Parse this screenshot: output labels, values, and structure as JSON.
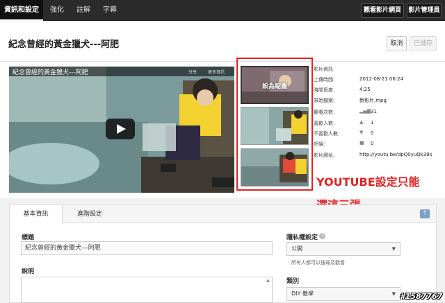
{
  "nav": {
    "tabs": [
      "資訊和設定",
      "強化",
      "註解",
      "字幕"
    ],
    "view_page_button": "觀看影片網頁",
    "video_manager_button": "影片管理員"
  },
  "header": {
    "video_title": "紀念曾經的黃金獵犬---阿肥",
    "cancel_label": "取消",
    "saved_label": "已儲存"
  },
  "player": {
    "title": "紀念曾經的黃金獵犬---阿肥",
    "share_label": "分享",
    "more_label": "更多資訊"
  },
  "thumbnails": {
    "selected_label": "設為縮圖"
  },
  "info": {
    "heading": "影片資訊",
    "upload_time_label": "上傳時間:",
    "upload_time": "2012-08-21 06:24",
    "duration_label": "時間長度:",
    "duration": "4:25",
    "original_file_label": "原始檔案:",
    "original_file": "新影片.mpg",
    "views_label": "觀看次數:",
    "views": "31",
    "likes_label": "喜歡人數:",
    "likes": "1",
    "dislikes_label": "不喜歡人數:",
    "dislikes": "0",
    "comments_label": "評論:",
    "comments": "0",
    "url_label": "影片網址:",
    "url": "http://youtu.be/dpQ0yuQk39s"
  },
  "annotation": {
    "line1": "YOUTUBE設定只能",
    "line2": "選這三張"
  },
  "form": {
    "tabs": [
      "基本資訊",
      "進階設定"
    ],
    "title_label": "標題",
    "title_value": "紀念曾經的黃金獵犬---阿肥",
    "description_label": "說明",
    "privacy_label": "隱私權設定",
    "privacy_value": "公開",
    "privacy_hint": "所有人都可以搜尋及觀看",
    "category_label": "類別",
    "category_value": "DIY 教學"
  },
  "watermark": "#1587767"
}
